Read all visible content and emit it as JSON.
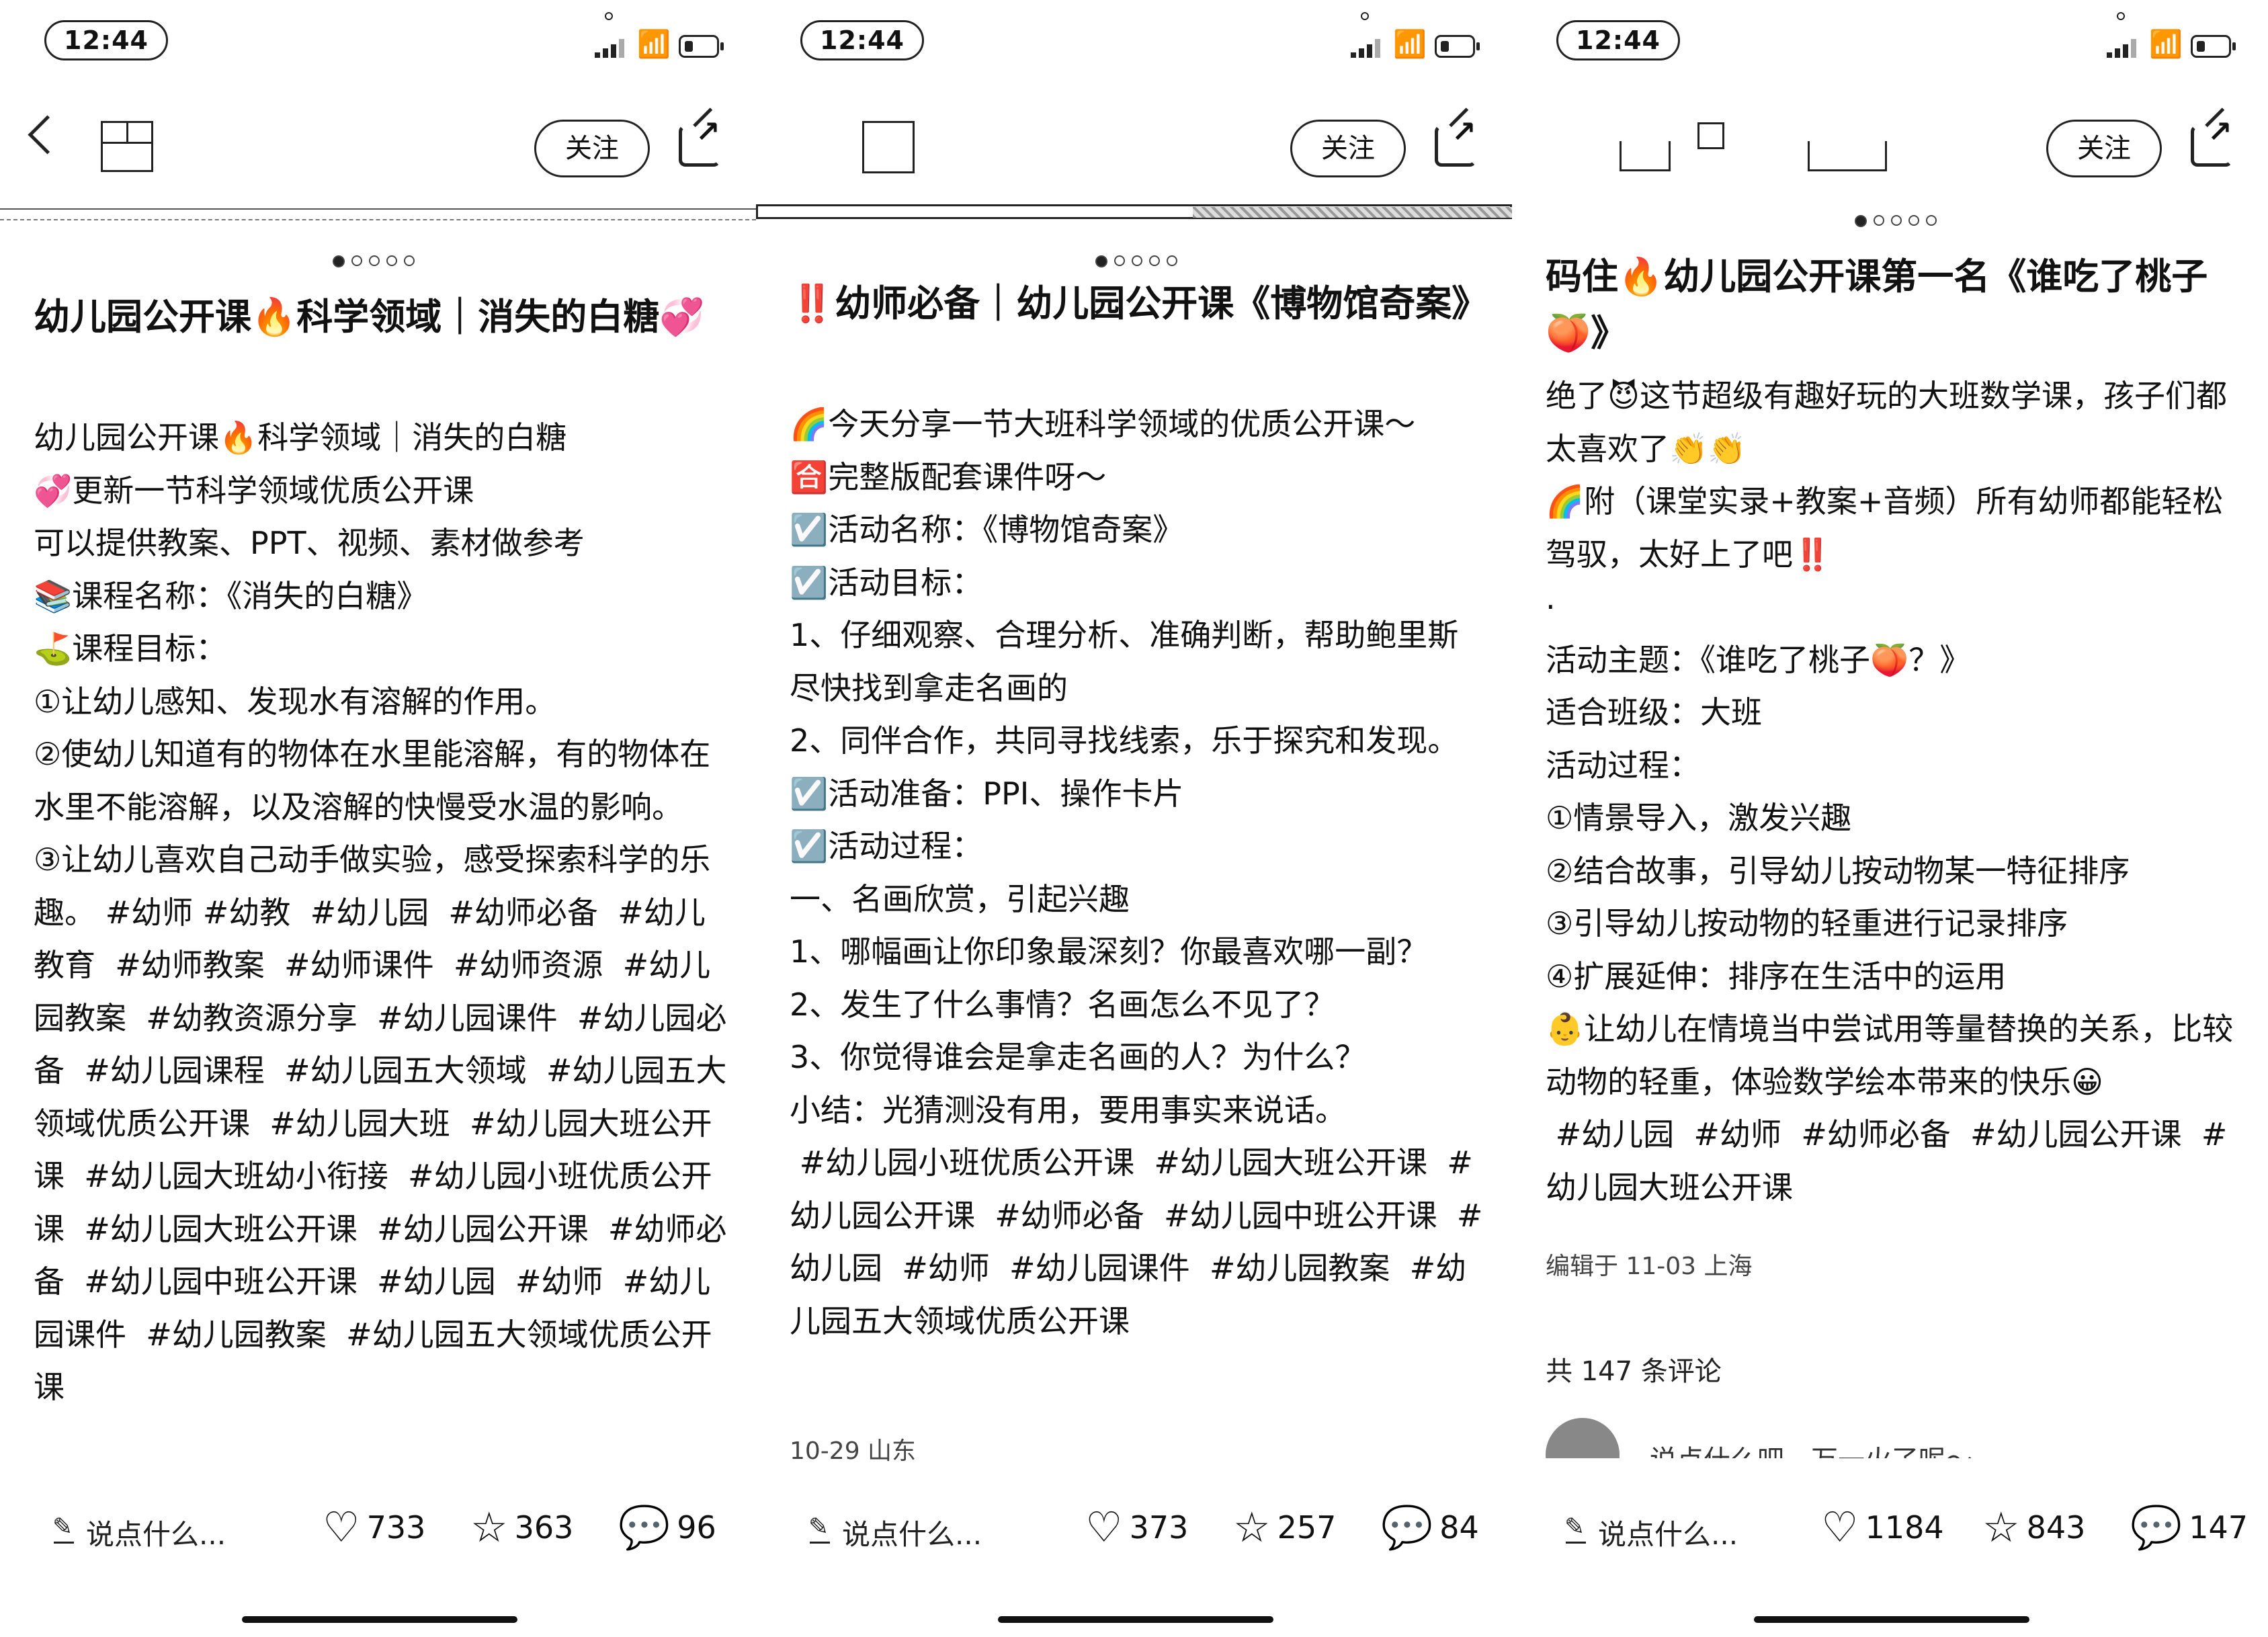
{
  "panels": [
    {
      "status": {
        "time": "12:44"
      },
      "header": {
        "follow": "关注"
      },
      "title": "幼儿园公开课🔥科学领域｜消失的白糖💞",
      "body": [
        "幼儿园公开课🔥科学领域｜消失的白糖",
        "💞更新一节科学领域优质公开课",
        "可以提供教案、PPT、视频、素材做参考",
        "📚课程名称：《消失的白糖》",
        "⛳课程目标：",
        "①让幼儿感知、发现水有溶解的作用。",
        "②使幼儿知道有的物体在水里能溶解，有的物体在水里不能溶解，以及溶解的快慢受水温的影响。",
        "③让幼儿喜欢自己动手做实验，感受探索科学的乐趣。 #幼师 #幼教  #幼儿园  #幼师必备  #幼儿教育  #幼师教案  #幼师课件  #幼师资源  #幼儿园教案  #幼教资源分享  #幼儿园课件  #幼儿园必备  #幼儿园课程  #幼儿园五大领域  #幼儿园五大领域优质公开课  #幼儿园大班  #幼儿园大班公开课  #幼儿园大班幼小衔接  #幼儿园小班优质公开课  #幼儿园大班公开课  #幼儿园公开课  #幼师必备  #幼儿园中班公开课  #幼儿园  #幼师  #幼儿园课件  #幼儿园教案  #幼儿园五大领域优质公开课"
      ],
      "bottom": {
        "say": "说点什么...",
        "likes": "733",
        "stars": "363",
        "comments": "96"
      }
    },
    {
      "status": {
        "time": "12:44"
      },
      "header": {
        "follow": "关注"
      },
      "title": "‼️幼师必备｜幼儿园公开课《博物馆奇案》",
      "body": [
        "🌈今天分享一节大班科学领域的优质公开课～",
        "🈴完整版配套课件呀～",
        "☑️活动名称：《博物馆奇案》",
        "☑️活动目标：",
        "1、仔细观察、合理分析、准确判断，帮助鲍里斯尽快找到拿走名画的",
        "2、同伴合作，共同寻找线索，乐于探究和发现。",
        "☑️活动准备：PPI、操作卡片",
        "☑️活动过程：",
        "一、名画欣赏，引起兴趣",
        "1、哪幅画让你印象最深刻？你最喜欢哪一副？",
        "2、发生了什么事情？名画怎么不见了？",
        "3、你觉得谁会是拿走名画的人？为什么？",
        "小结：光猜测没有用，要用事实来说话。",
        " #幼儿园小班优质公开课  #幼儿园大班公开课  #幼儿园公开课  #幼师必备  #幼儿园中班公开课  #幼儿园  #幼师  #幼儿园课件  #幼儿园教案  #幼儿园五大领域优质公开课"
      ],
      "meta": "10-29 山东",
      "bottom": {
        "say": "说点什么...",
        "likes": "373",
        "stars": "257",
        "comments": "84"
      }
    },
    {
      "status": {
        "time": "12:44"
      },
      "header": {
        "follow": "关注"
      },
      "title": "码住🔥幼儿园公开课第一名《谁吃了桃子🍑》",
      "body": [
        "绝了😈这节超级有趣好玩的大班数学课，孩子们都太喜欢了👏👏",
        "🌈附（课堂实录+教案+音频）所有幼师都能轻松驾驭，太好上了吧‼️",
        "·",
        "活动主题：《谁吃了桃子🍑？》",
        "适合班级：大班",
        "活动过程：",
        "①情景导入，激发兴趣",
        "②结合故事，引导幼儿按动物某一特征排序",
        "③引导幼儿按动物的轻重进行记录排序",
        "④扩展延伸：排序在生活中的运用",
        "👶让幼儿在情境当中尝试用等量替换的关系，比较动物的轻重，体验数学绘本带来的快乐😀",
        " #幼儿园  #幼师  #幼师必备  #幼儿园公开课  #幼儿园大班公开课"
      ],
      "meta": "编辑于 11-03 上海",
      "comment_count": "共 147 条评论",
      "comment_preview": "说点什么吧，万一火了呢～",
      "bottom": {
        "say": "说点什么...",
        "likes": "1184",
        "stars": "843",
        "comments": "147"
      }
    }
  ]
}
